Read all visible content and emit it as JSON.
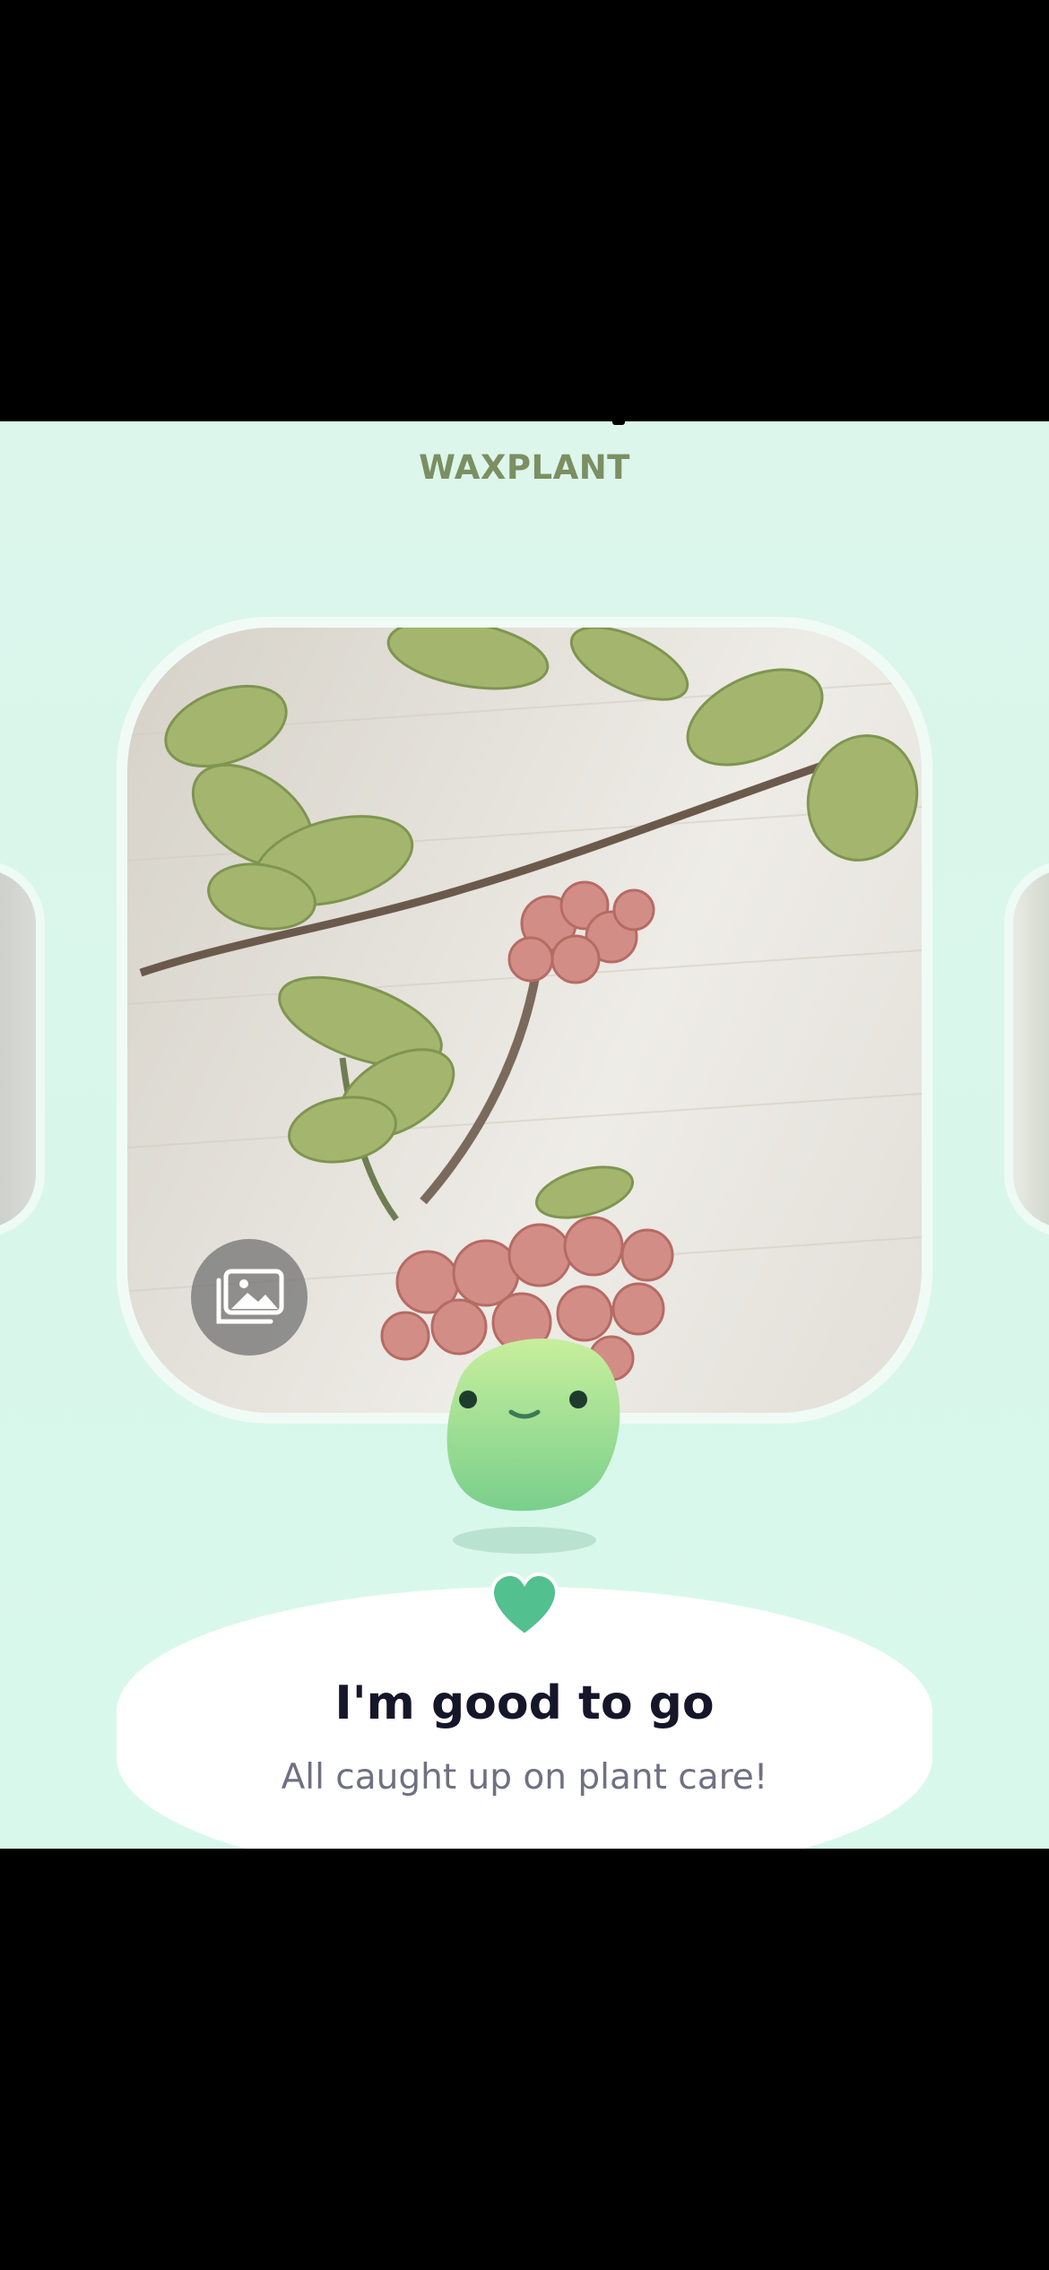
{
  "plant": {
    "name": "WAXPLANT"
  },
  "status": {
    "title": "I'm good to go",
    "subtitle": "All caught up on plant care!"
  },
  "icons": {
    "gallery": "gallery-icon",
    "heart": "heart-icon"
  },
  "colors": {
    "background": "#dcf6ec",
    "plant_name": "#7c8f62",
    "heart": "#52c08f",
    "title": "#16162a",
    "subtitle": "#707083"
  }
}
